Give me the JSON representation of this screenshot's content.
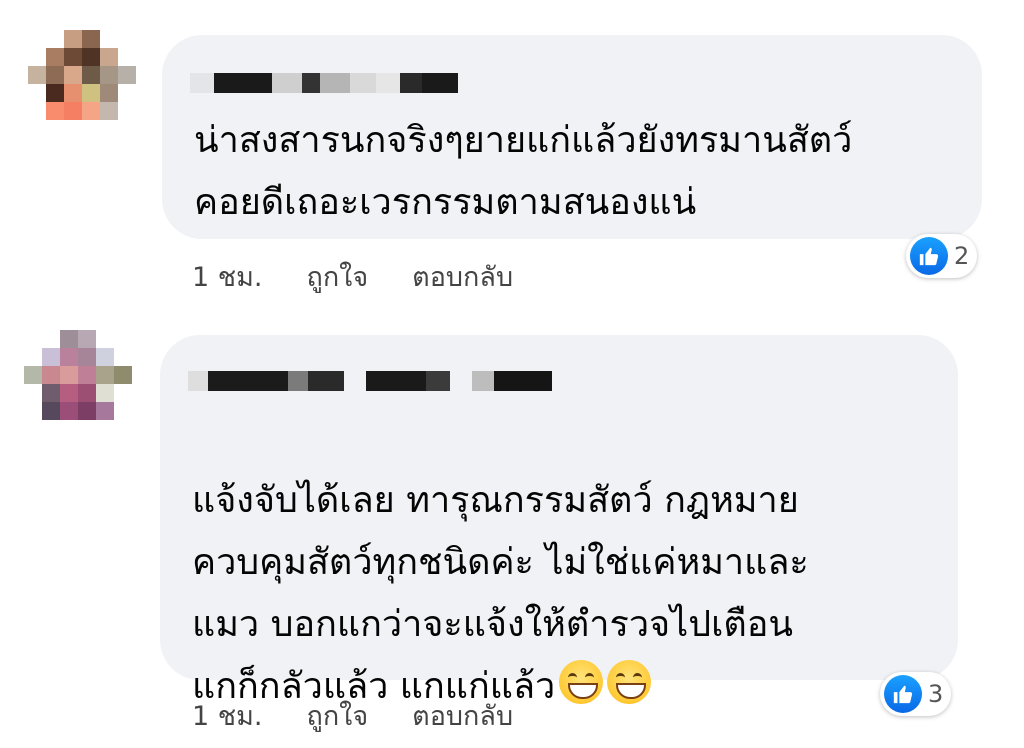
{
  "comments": [
    {
      "text": "น่าสงสารนกจริงๆยายแก่แล้วยังทรมานสัตว์\nคอยดีเถอะเวรกรรมตามสนองแน่",
      "time": "1 ชม.",
      "like_label": "ถูกใจ",
      "reply_label": "ตอบกลับ",
      "reaction_count": "2",
      "reaction_icon": "like-icon",
      "emoji_count": 0
    },
    {
      "text": "แจ้งจับได้เลย ทารุณกรรมสัตว์ กฎหมาย\nควบคุมสัตว์ทุกชนิดค่ะ ไม่ใช่แค่หมาและ\nแมว บอกแกว่าจะแจ้งให้ตำรวจไปเตือน\nแกก็กลัวแล้ว แกแก่แล้ว",
      "time": "1 ชม.",
      "like_label": "ถูกใจ",
      "reply_label": "ตอบกลับ",
      "reaction_count": "3",
      "reaction_icon": "like-icon",
      "emoji_count": 2,
      "emoji_icon": "grinning-face-icon"
    }
  ],
  "colors": {
    "bubble": "#f0f2f5",
    "like_blue": "#1877f2",
    "action_text": "#444444"
  }
}
